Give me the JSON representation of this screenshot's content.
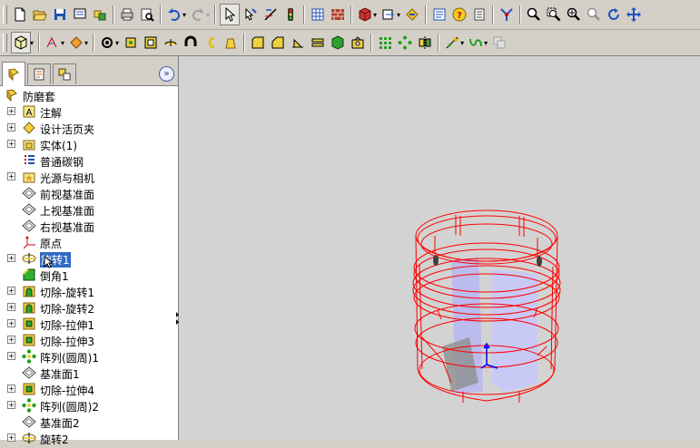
{
  "feature_tree": {
    "root": "防磨套",
    "items": [
      {
        "label": "注解",
        "icon": "annotations-icon",
        "expandable": true
      },
      {
        "label": "设计活页夹",
        "icon": "design-binder-icon",
        "expandable": true
      },
      {
        "label": "实体(1)",
        "icon": "solid-bodies-icon",
        "expandable": true
      },
      {
        "label": "普通碳钢",
        "icon": "material-icon",
        "expandable": false
      },
      {
        "label": "光源与相机",
        "icon": "lights-cameras-icon",
        "expandable": true
      },
      {
        "label": "前视基准面",
        "icon": "plane-icon",
        "expandable": false
      },
      {
        "label": "上视基准面",
        "icon": "plane-icon",
        "expandable": false
      },
      {
        "label": "右视基准面",
        "icon": "plane-icon",
        "expandable": false
      },
      {
        "label": "原点",
        "icon": "origin-icon",
        "expandable": false
      },
      {
        "label": "旋转1",
        "icon": "revolve-icon",
        "expandable": true,
        "selected": true
      },
      {
        "label": "倒角1",
        "icon": "chamfer-icon",
        "expandable": false
      },
      {
        "label": "切除-旋转1",
        "icon": "cut-revolve-icon",
        "expandable": true
      },
      {
        "label": "切除-旋转2",
        "icon": "cut-revolve-icon",
        "expandable": true
      },
      {
        "label": "切除-拉伸1",
        "icon": "cut-extrude-icon",
        "expandable": true
      },
      {
        "label": "切除-拉伸3",
        "icon": "cut-extrude-icon",
        "expandable": true
      },
      {
        "label": "阵列(圆周)1",
        "icon": "circular-pattern-icon",
        "expandable": true
      },
      {
        "label": "基准面1",
        "icon": "plane-icon",
        "expandable": false
      },
      {
        "label": "切除-拉伸4",
        "icon": "cut-extrude-icon",
        "expandable": true
      },
      {
        "label": "阵列(圆周)2",
        "icon": "circular-pattern-icon",
        "expandable": true
      },
      {
        "label": "基准面2",
        "icon": "plane-icon",
        "expandable": false
      },
      {
        "label": "旋转2",
        "icon": "revolve-icon",
        "expandable": true
      }
    ]
  },
  "colors": {
    "selection": "#316ac5",
    "viewport_bg": "#d3d3d3",
    "model_edges": "#ff0000",
    "model_faces": "#b8b8f0",
    "triad": "#0000ff"
  }
}
